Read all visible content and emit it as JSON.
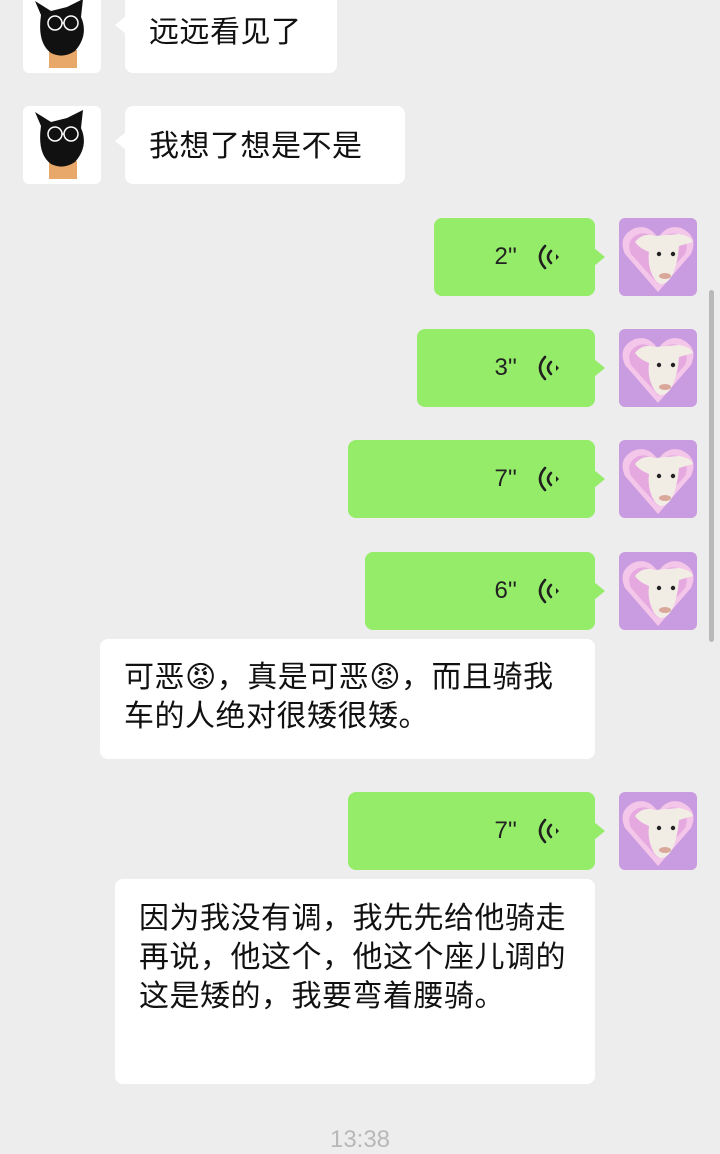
{
  "messages": [
    {
      "side": "left",
      "type": "text",
      "text": "远远看见了"
    },
    {
      "side": "left",
      "type": "text",
      "text": "我想了想是不是"
    },
    {
      "side": "right",
      "type": "voice",
      "duration": "2''"
    },
    {
      "side": "right",
      "type": "voice",
      "duration": "3''"
    },
    {
      "side": "right",
      "type": "voice",
      "duration": "7''"
    },
    {
      "side": "right",
      "type": "voice",
      "duration": "6''"
    },
    {
      "side": "left",
      "type": "transcript",
      "text": "可恶😡，真是可恶😡，而且骑我车的人绝对很矮很矮。"
    },
    {
      "side": "right",
      "type": "voice",
      "duration": "7''"
    },
    {
      "side": "left",
      "type": "transcript",
      "text": "因为我没有调，我先先给他骑走再说，他这个，他这个座儿调的这是矮的，我要弯着腰骑。"
    }
  ],
  "timestamp": "13:38",
  "icons": {
    "voice": "voice-wave-icon",
    "left_avatar": "black-cat-avatar",
    "right_avatar": "lamb-avatar"
  },
  "colors": {
    "background": "#ededed",
    "bubble_right": "#95ec69",
    "bubble_left": "#ffffff"
  }
}
